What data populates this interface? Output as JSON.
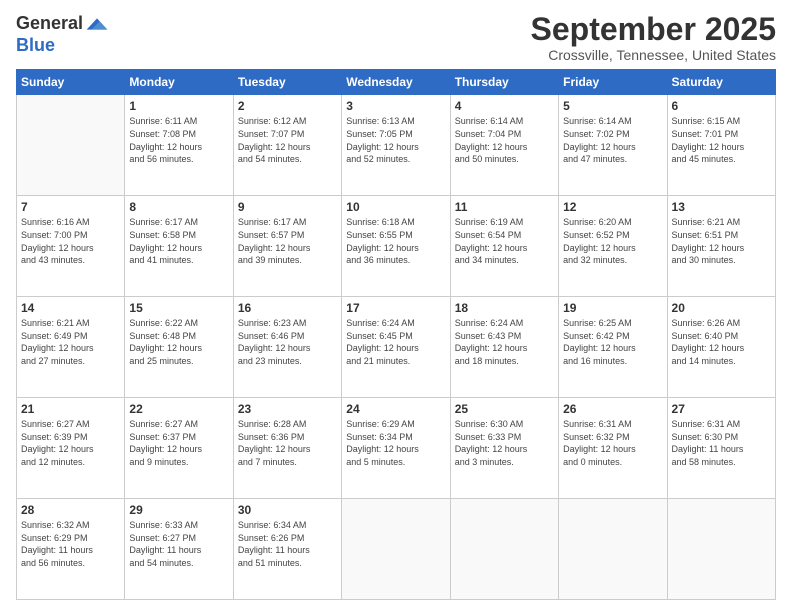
{
  "logo": {
    "line1": "General",
    "line2": "Blue"
  },
  "title": "September 2025",
  "location": "Crossville, Tennessee, United States",
  "weekdays": [
    "Sunday",
    "Monday",
    "Tuesday",
    "Wednesday",
    "Thursday",
    "Friday",
    "Saturday"
  ],
  "weeks": [
    [
      {
        "day": "",
        "info": ""
      },
      {
        "day": "1",
        "info": "Sunrise: 6:11 AM\nSunset: 7:08 PM\nDaylight: 12 hours\nand 56 minutes."
      },
      {
        "day": "2",
        "info": "Sunrise: 6:12 AM\nSunset: 7:07 PM\nDaylight: 12 hours\nand 54 minutes."
      },
      {
        "day": "3",
        "info": "Sunrise: 6:13 AM\nSunset: 7:05 PM\nDaylight: 12 hours\nand 52 minutes."
      },
      {
        "day": "4",
        "info": "Sunrise: 6:14 AM\nSunset: 7:04 PM\nDaylight: 12 hours\nand 50 minutes."
      },
      {
        "day": "5",
        "info": "Sunrise: 6:14 AM\nSunset: 7:02 PM\nDaylight: 12 hours\nand 47 minutes."
      },
      {
        "day": "6",
        "info": "Sunrise: 6:15 AM\nSunset: 7:01 PM\nDaylight: 12 hours\nand 45 minutes."
      }
    ],
    [
      {
        "day": "7",
        "info": "Sunrise: 6:16 AM\nSunset: 7:00 PM\nDaylight: 12 hours\nand 43 minutes."
      },
      {
        "day": "8",
        "info": "Sunrise: 6:17 AM\nSunset: 6:58 PM\nDaylight: 12 hours\nand 41 minutes."
      },
      {
        "day": "9",
        "info": "Sunrise: 6:17 AM\nSunset: 6:57 PM\nDaylight: 12 hours\nand 39 minutes."
      },
      {
        "day": "10",
        "info": "Sunrise: 6:18 AM\nSunset: 6:55 PM\nDaylight: 12 hours\nand 36 minutes."
      },
      {
        "day": "11",
        "info": "Sunrise: 6:19 AM\nSunset: 6:54 PM\nDaylight: 12 hours\nand 34 minutes."
      },
      {
        "day": "12",
        "info": "Sunrise: 6:20 AM\nSunset: 6:52 PM\nDaylight: 12 hours\nand 32 minutes."
      },
      {
        "day": "13",
        "info": "Sunrise: 6:21 AM\nSunset: 6:51 PM\nDaylight: 12 hours\nand 30 minutes."
      }
    ],
    [
      {
        "day": "14",
        "info": "Sunrise: 6:21 AM\nSunset: 6:49 PM\nDaylight: 12 hours\nand 27 minutes."
      },
      {
        "day": "15",
        "info": "Sunrise: 6:22 AM\nSunset: 6:48 PM\nDaylight: 12 hours\nand 25 minutes."
      },
      {
        "day": "16",
        "info": "Sunrise: 6:23 AM\nSunset: 6:46 PM\nDaylight: 12 hours\nand 23 minutes."
      },
      {
        "day": "17",
        "info": "Sunrise: 6:24 AM\nSunset: 6:45 PM\nDaylight: 12 hours\nand 21 minutes."
      },
      {
        "day": "18",
        "info": "Sunrise: 6:24 AM\nSunset: 6:43 PM\nDaylight: 12 hours\nand 18 minutes."
      },
      {
        "day": "19",
        "info": "Sunrise: 6:25 AM\nSunset: 6:42 PM\nDaylight: 12 hours\nand 16 minutes."
      },
      {
        "day": "20",
        "info": "Sunrise: 6:26 AM\nSunset: 6:40 PM\nDaylight: 12 hours\nand 14 minutes."
      }
    ],
    [
      {
        "day": "21",
        "info": "Sunrise: 6:27 AM\nSunset: 6:39 PM\nDaylight: 12 hours\nand 12 minutes."
      },
      {
        "day": "22",
        "info": "Sunrise: 6:27 AM\nSunset: 6:37 PM\nDaylight: 12 hours\nand 9 minutes."
      },
      {
        "day": "23",
        "info": "Sunrise: 6:28 AM\nSunset: 6:36 PM\nDaylight: 12 hours\nand 7 minutes."
      },
      {
        "day": "24",
        "info": "Sunrise: 6:29 AM\nSunset: 6:34 PM\nDaylight: 12 hours\nand 5 minutes."
      },
      {
        "day": "25",
        "info": "Sunrise: 6:30 AM\nSunset: 6:33 PM\nDaylight: 12 hours\nand 3 minutes."
      },
      {
        "day": "26",
        "info": "Sunrise: 6:31 AM\nSunset: 6:32 PM\nDaylight: 12 hours\nand 0 minutes."
      },
      {
        "day": "27",
        "info": "Sunrise: 6:31 AM\nSunset: 6:30 PM\nDaylight: 11 hours\nand 58 minutes."
      }
    ],
    [
      {
        "day": "28",
        "info": "Sunrise: 6:32 AM\nSunset: 6:29 PM\nDaylight: 11 hours\nand 56 minutes."
      },
      {
        "day": "29",
        "info": "Sunrise: 6:33 AM\nSunset: 6:27 PM\nDaylight: 11 hours\nand 54 minutes."
      },
      {
        "day": "30",
        "info": "Sunrise: 6:34 AM\nSunset: 6:26 PM\nDaylight: 11 hours\nand 51 minutes."
      },
      {
        "day": "",
        "info": ""
      },
      {
        "day": "",
        "info": ""
      },
      {
        "day": "",
        "info": ""
      },
      {
        "day": "",
        "info": ""
      }
    ]
  ]
}
